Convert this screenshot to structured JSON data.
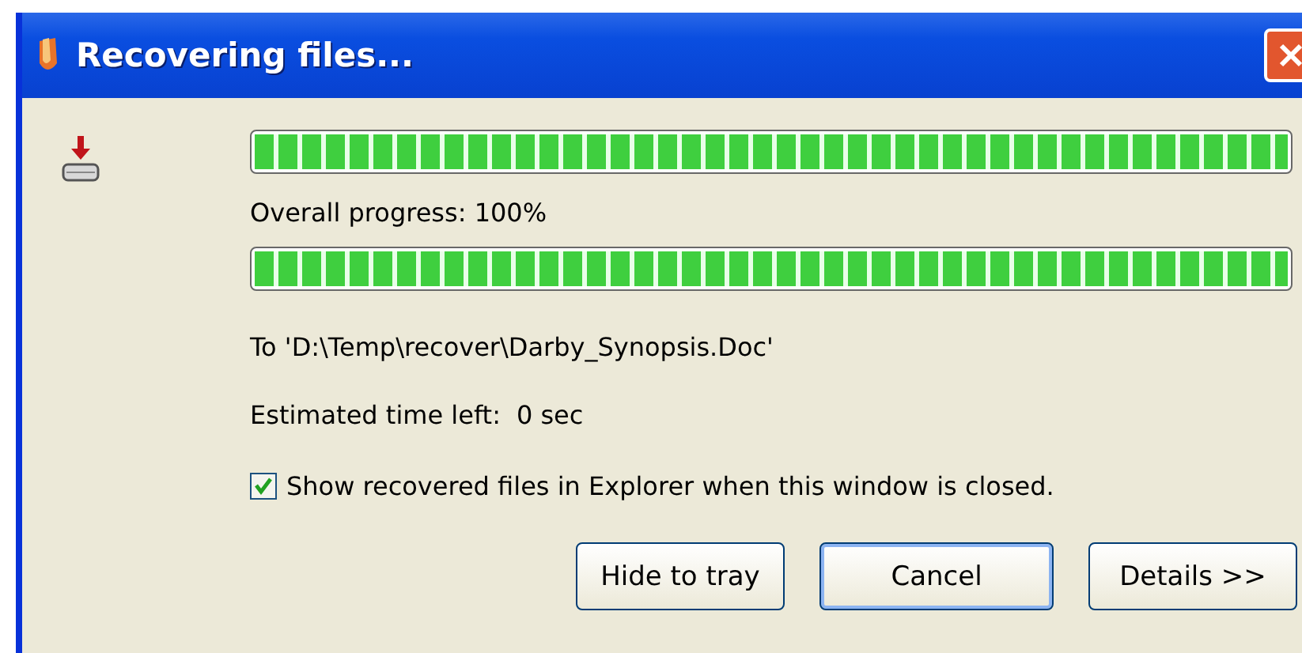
{
  "window": {
    "title": "Recovering files..."
  },
  "file_progress": {
    "level": 1
  },
  "overall_progress": {
    "label": "Overall progress: 100%",
    "level": 1
  },
  "destination": "To 'D:\\Temp\\recover\\Darby_Synopsis.Doc'",
  "time_left": {
    "label": "Estimated time left:",
    "value": "0 sec"
  },
  "show_in_explorer": {
    "label": "Show recovered files in Explorer when this window is closed.",
    "checked": true
  },
  "buttons": [
    {
      "label": "Hide to tray",
      "default": false
    },
    {
      "label": "Cancel",
      "default": true
    },
    {
      "label": "Details >>",
      "default": false
    }
  ]
}
